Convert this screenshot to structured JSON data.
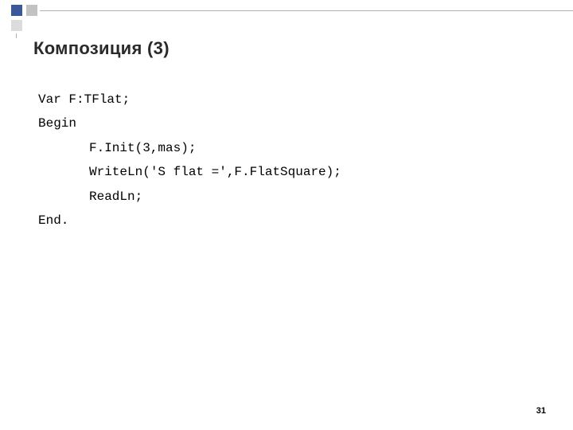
{
  "title": "Композиция (3)",
  "code": {
    "line1": "Var F:TFlat;",
    "line2": "Begin",
    "line3": "F.Init(3,mas);",
    "line4": "WriteLn('S flat =',F.FlatSquare);",
    "line5": "ReadLn;",
    "line6": "End."
  },
  "page_number": "31"
}
